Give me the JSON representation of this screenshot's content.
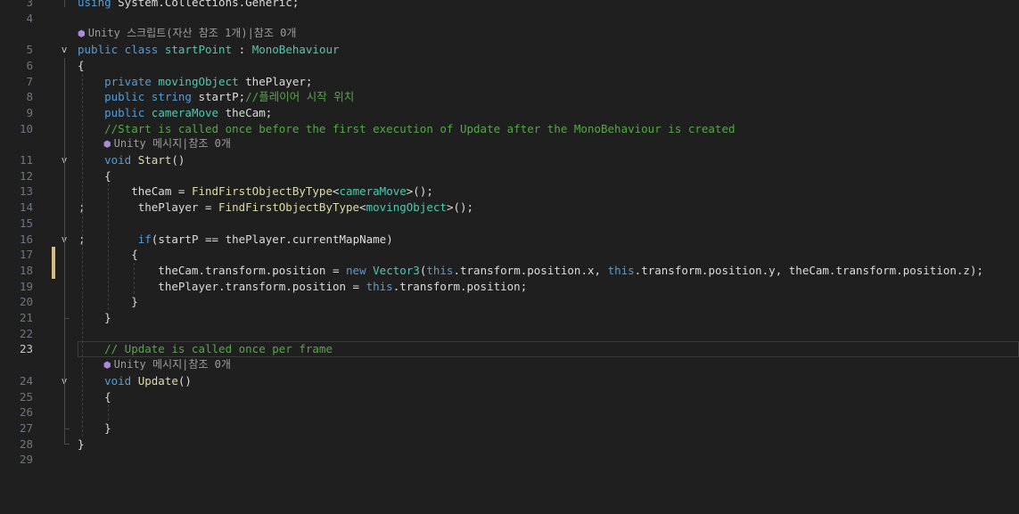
{
  "editor": {
    "rows": [
      {
        "kind": "code",
        "ln": "3",
        "fold": "",
        "parts": [
          [
            "using ",
            "k"
          ],
          [
            "System.Collections.Generic;",
            "p"
          ]
        ]
      },
      {
        "kind": "code",
        "ln": "4",
        "fold": "",
        "parts": []
      },
      {
        "kind": "lens",
        "ln": "",
        "fold": "",
        "parts": [
          [
            "Unity 스크립트(자산 참조 1개)|참조 0개",
            "lens"
          ]
        ]
      },
      {
        "kind": "code",
        "ln": "5",
        "fold": "v",
        "parts": [
          [
            "public class ",
            "k"
          ],
          [
            "startPoint",
            "t"
          ],
          [
            " : ",
            "p"
          ],
          [
            "MonoBehaviour",
            "t"
          ]
        ]
      },
      {
        "kind": "code",
        "ln": "6",
        "fold": "",
        "parts": [
          [
            "{",
            "p"
          ]
        ]
      },
      {
        "kind": "code",
        "ln": "7",
        "fold": "",
        "parts": [
          [
            "    private ",
            "k"
          ],
          [
            "movingObject",
            "t"
          ],
          [
            " thePlayer;",
            "p"
          ]
        ]
      },
      {
        "kind": "code",
        "ln": "8",
        "fold": "",
        "parts": [
          [
            "    public string ",
            "k"
          ],
          [
            "startP;",
            "p"
          ],
          [
            "//플레이어 시작 위치",
            "c"
          ]
        ]
      },
      {
        "kind": "code",
        "ln": "9",
        "fold": "",
        "parts": [
          [
            "    public ",
            "k"
          ],
          [
            "cameraMove",
            "t"
          ],
          [
            " theCam;",
            "p"
          ]
        ]
      },
      {
        "kind": "code",
        "ln": "10",
        "fold": "",
        "parts": [
          [
            "    //Start is called once before the first execution of Update after the MonoBehaviour is created",
            "c"
          ]
        ]
      },
      {
        "kind": "lens",
        "ln": "",
        "fold": "",
        "indent": "    ",
        "parts": [
          [
            "Unity 메시지|참조 0개",
            "lens"
          ]
        ]
      },
      {
        "kind": "code",
        "ln": "11",
        "fold": "v",
        "parts": [
          [
            "    void ",
            "k"
          ],
          [
            "Start",
            "m"
          ],
          [
            "()",
            "p"
          ]
        ]
      },
      {
        "kind": "code",
        "ln": "12",
        "fold": "",
        "parts": [
          [
            "    {",
            "p"
          ]
        ]
      },
      {
        "kind": "code",
        "ln": "13",
        "fold": "",
        "parts": [
          [
            "        theCam = ",
            "p"
          ],
          [
            "FindFirstObjectByType",
            "m"
          ],
          [
            "<",
            "p"
          ],
          [
            "cameraMove",
            "t"
          ],
          [
            ">();",
            "p"
          ]
        ]
      },
      {
        "kind": "code",
        "ln": "14",
        "fold": "",
        "semi": ";",
        "parts": [
          [
            "         thePlayer = ",
            "p"
          ],
          [
            "FindFirstObjectByType",
            "m"
          ],
          [
            "<",
            "p"
          ],
          [
            "movingObject",
            "t"
          ],
          [
            ">();",
            "p"
          ]
        ]
      },
      {
        "kind": "code",
        "ln": "15",
        "fold": "",
        "parts": []
      },
      {
        "kind": "code",
        "ln": "16",
        "fold": "v",
        "semi": ";",
        "parts": [
          [
            "         if",
            "k"
          ],
          [
            "(startP == thePlayer.currentMapName)",
            "p"
          ]
        ]
      },
      {
        "kind": "code",
        "ln": "17",
        "fold": "",
        "parts": [
          [
            "        {",
            "p"
          ]
        ]
      },
      {
        "kind": "code",
        "ln": "18",
        "fold": "",
        "parts": [
          [
            "            theCam.transform.position = ",
            "p"
          ],
          [
            "new ",
            "k"
          ],
          [
            "Vector3",
            "t"
          ],
          [
            "(",
            "p"
          ],
          [
            "this",
            "k"
          ],
          [
            ".transform.position.x, ",
            "p"
          ],
          [
            "this",
            "k"
          ],
          [
            ".transform.position.y, theCam.transform.position.z);",
            "p"
          ]
        ]
      },
      {
        "kind": "code",
        "ln": "19",
        "fold": "",
        "parts": [
          [
            "            thePlayer.transform.position = ",
            "p"
          ],
          [
            "this",
            "k"
          ],
          [
            ".transform.position;",
            "p"
          ]
        ]
      },
      {
        "kind": "code",
        "ln": "20",
        "fold": "",
        "parts": [
          [
            "        }",
            "p"
          ]
        ]
      },
      {
        "kind": "code",
        "ln": "21",
        "fold": "",
        "parts": [
          [
            "    }",
            "p"
          ]
        ]
      },
      {
        "kind": "code",
        "ln": "22",
        "fold": "",
        "parts": []
      },
      {
        "kind": "code",
        "ln": "23",
        "fold": "",
        "current": true,
        "parts": [
          [
            "    // Update is called once per frame",
            "c"
          ]
        ]
      },
      {
        "kind": "lens",
        "ln": "",
        "fold": "",
        "indent": "    ",
        "parts": [
          [
            "Unity 메시지|참조 0개",
            "lens"
          ]
        ]
      },
      {
        "kind": "code",
        "ln": "24",
        "fold": "v",
        "parts": [
          [
            "    void ",
            "k"
          ],
          [
            "Update",
            "m"
          ],
          [
            "()",
            "p"
          ]
        ]
      },
      {
        "kind": "code",
        "ln": "25",
        "fold": "",
        "parts": [
          [
            "    {",
            "p"
          ]
        ]
      },
      {
        "kind": "code",
        "ln": "26",
        "fold": "",
        "parts": []
      },
      {
        "kind": "code",
        "ln": "27",
        "fold": "",
        "parts": [
          [
            "    }",
            "p"
          ]
        ]
      },
      {
        "kind": "code",
        "ln": "28",
        "fold": "",
        "parts": [
          [
            "}",
            "p"
          ]
        ]
      },
      {
        "kind": "code",
        "ln": "29",
        "fold": "",
        "parts": []
      }
    ]
  },
  "colors": {
    "background": "#1f1f1f",
    "keyword": "#569cd6",
    "type": "#4ec9b0",
    "comment": "#57a64a",
    "method": "#dcdcaa",
    "text": "#dcdcdc",
    "line_number": "#6e7681",
    "modified_marker": "#d7ba7d"
  },
  "icons": {
    "unity_lens": "unity-icon",
    "fold": "chevron-down-icon"
  }
}
